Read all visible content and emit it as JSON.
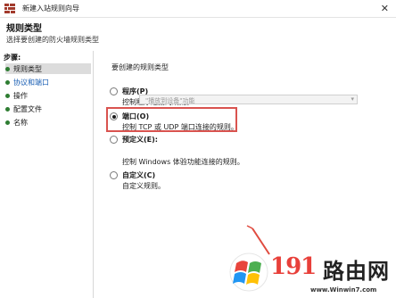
{
  "window": {
    "title": "新建入站规则向导",
    "close_glyph": "✕"
  },
  "header": {
    "title": "规则类型",
    "subtitle": "选择要创建的防火墙规则类型"
  },
  "sidebar": {
    "heading": "步骤:",
    "items": [
      {
        "label": "规则类型",
        "dot_color": "#2e7d32",
        "current": true
      },
      {
        "label": "协议和端口",
        "dot_color": "#2e7d32",
        "current": false,
        "link": true
      },
      {
        "label": "操作",
        "dot_color": "#2e7d32",
        "current": false
      },
      {
        "label": "配置文件",
        "dot_color": "#2e7d32",
        "current": false
      },
      {
        "label": "名称",
        "dot_color": "#2e7d32",
        "current": false
      }
    ]
  },
  "main": {
    "question": "要创建的规则类型",
    "options": [
      {
        "label": "程序(P)",
        "desc": "控制程序连接的规则。",
        "checked": false
      },
      {
        "label": "端口(O)",
        "desc": "控制 TCP 或 UDP 端口连接的规则。",
        "checked": true
      },
      {
        "label": "预定义(E):",
        "desc": "控制 Windows 体验功能连接的规则。",
        "checked": false
      },
      {
        "label": "自定义(C)",
        "desc": "自定义规则。",
        "checked": false
      }
    ],
    "predefined_dropdown": {
      "value": "\"播放到设备\"功能"
    }
  },
  "watermark": {
    "number": "191",
    "text": "路由网",
    "url": "www.Winwin7.com"
  },
  "colors": {
    "highlight": "#d9534f",
    "link": "#1a5fb4",
    "watermark_red": "#e8403a"
  }
}
